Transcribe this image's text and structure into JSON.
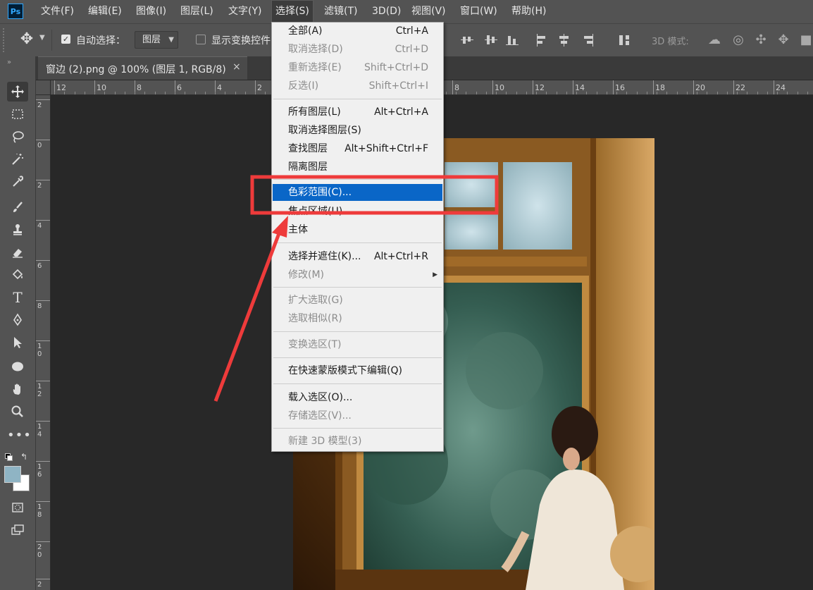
{
  "app": {
    "logo_text": "Ps"
  },
  "menubar": {
    "items": [
      "文件(F)",
      "编辑(E)",
      "图像(I)",
      "图层(L)",
      "文字(Y)",
      "选择(S)",
      "滤镜(T)",
      "3D(D)",
      "视图(V)",
      "窗口(W)",
      "帮助(H)"
    ],
    "active": "选择(S)"
  },
  "options_bar": {
    "auto_select_label": "自动选择：",
    "auto_select_checked": true,
    "target_select_value": "图层",
    "show_transform_label": "显示变换控件",
    "show_transform_checked": false,
    "mode_3d_label": "3D 模式:"
  },
  "document_tab": {
    "title": "窗边 (2).png @ 100% (图层 1, RGB/8)",
    "close_glyph": "×"
  },
  "rulers": {
    "horizontal_labels": [
      "12",
      "10",
      "8",
      "6",
      "4",
      "2",
      "8",
      "10",
      "12",
      "14",
      "16",
      "18",
      "20",
      "22",
      "24"
    ],
    "vertical_labels": [
      "2",
      "0",
      "2",
      "4",
      "6",
      "8",
      "10",
      "12",
      "14",
      "16",
      "18",
      "20",
      "2"
    ]
  },
  "select_menu": {
    "groups": [
      [
        {
          "label": "全部(A)",
          "shortcut": "Ctrl+A",
          "enabled": true
        },
        {
          "label": "取消选择(D)",
          "shortcut": "Ctrl+D",
          "enabled": false
        },
        {
          "label": "重新选择(E)",
          "shortcut": "Shift+Ctrl+D",
          "enabled": false
        },
        {
          "label": "反选(I)",
          "shortcut": "Shift+Ctrl+I",
          "enabled": false
        }
      ],
      [
        {
          "label": "所有图层(L)",
          "shortcut": "Alt+Ctrl+A",
          "enabled": true
        },
        {
          "label": "取消选择图层(S)",
          "shortcut": "",
          "enabled": true
        },
        {
          "label": "查找图层",
          "shortcut": "Alt+Shift+Ctrl+F",
          "enabled": true
        },
        {
          "label": "隔离图层",
          "shortcut": "",
          "enabled": true
        }
      ],
      [
        {
          "label": "色彩范围(C)...",
          "shortcut": "",
          "enabled": true,
          "highlighted": true
        },
        {
          "label": "焦点区域(U)...",
          "shortcut": "",
          "enabled": true
        },
        {
          "label": "主体",
          "shortcut": "",
          "enabled": true
        }
      ],
      [
        {
          "label": "选择并遮住(K)...",
          "shortcut": "Alt+Ctrl+R",
          "enabled": true
        },
        {
          "label": "修改(M)",
          "shortcut": "",
          "enabled": false,
          "submenu": true
        }
      ],
      [
        {
          "label": "扩大选取(G)",
          "shortcut": "",
          "enabled": false
        },
        {
          "label": "选取相似(R)",
          "shortcut": "",
          "enabled": false
        }
      ],
      [
        {
          "label": "变换选区(T)",
          "shortcut": "",
          "enabled": false
        }
      ],
      [
        {
          "label": "在快速蒙版模式下编辑(Q)",
          "shortcut": "",
          "enabled": true
        }
      ],
      [
        {
          "label": "载入选区(O)...",
          "shortcut": "",
          "enabled": true
        },
        {
          "label": "存储选区(V)...",
          "shortcut": "",
          "enabled": false
        }
      ],
      [
        {
          "label": "新建 3D 模型(3)",
          "shortcut": "",
          "enabled": false
        }
      ]
    ]
  },
  "tools": [
    "move-tool",
    "marquee-tool",
    "lasso-tool",
    "magic-wand-tool",
    "eyedropper-tool",
    "brush-tool",
    "stamp-tool",
    "eraser-tool",
    "paint-bucket-tool",
    "type-tool",
    "pen-tool",
    "path-select-tool",
    "ellipse-tool",
    "hand-tool",
    "zoom-tool",
    "more-tools"
  ],
  "colors": {
    "ui_dark": "#535353",
    "menu_highlight": "#0a66c7",
    "annotation_red": "#ee3b3b",
    "foreground_swatch": "#8fb4c4",
    "background_swatch": "#ffffff"
  }
}
